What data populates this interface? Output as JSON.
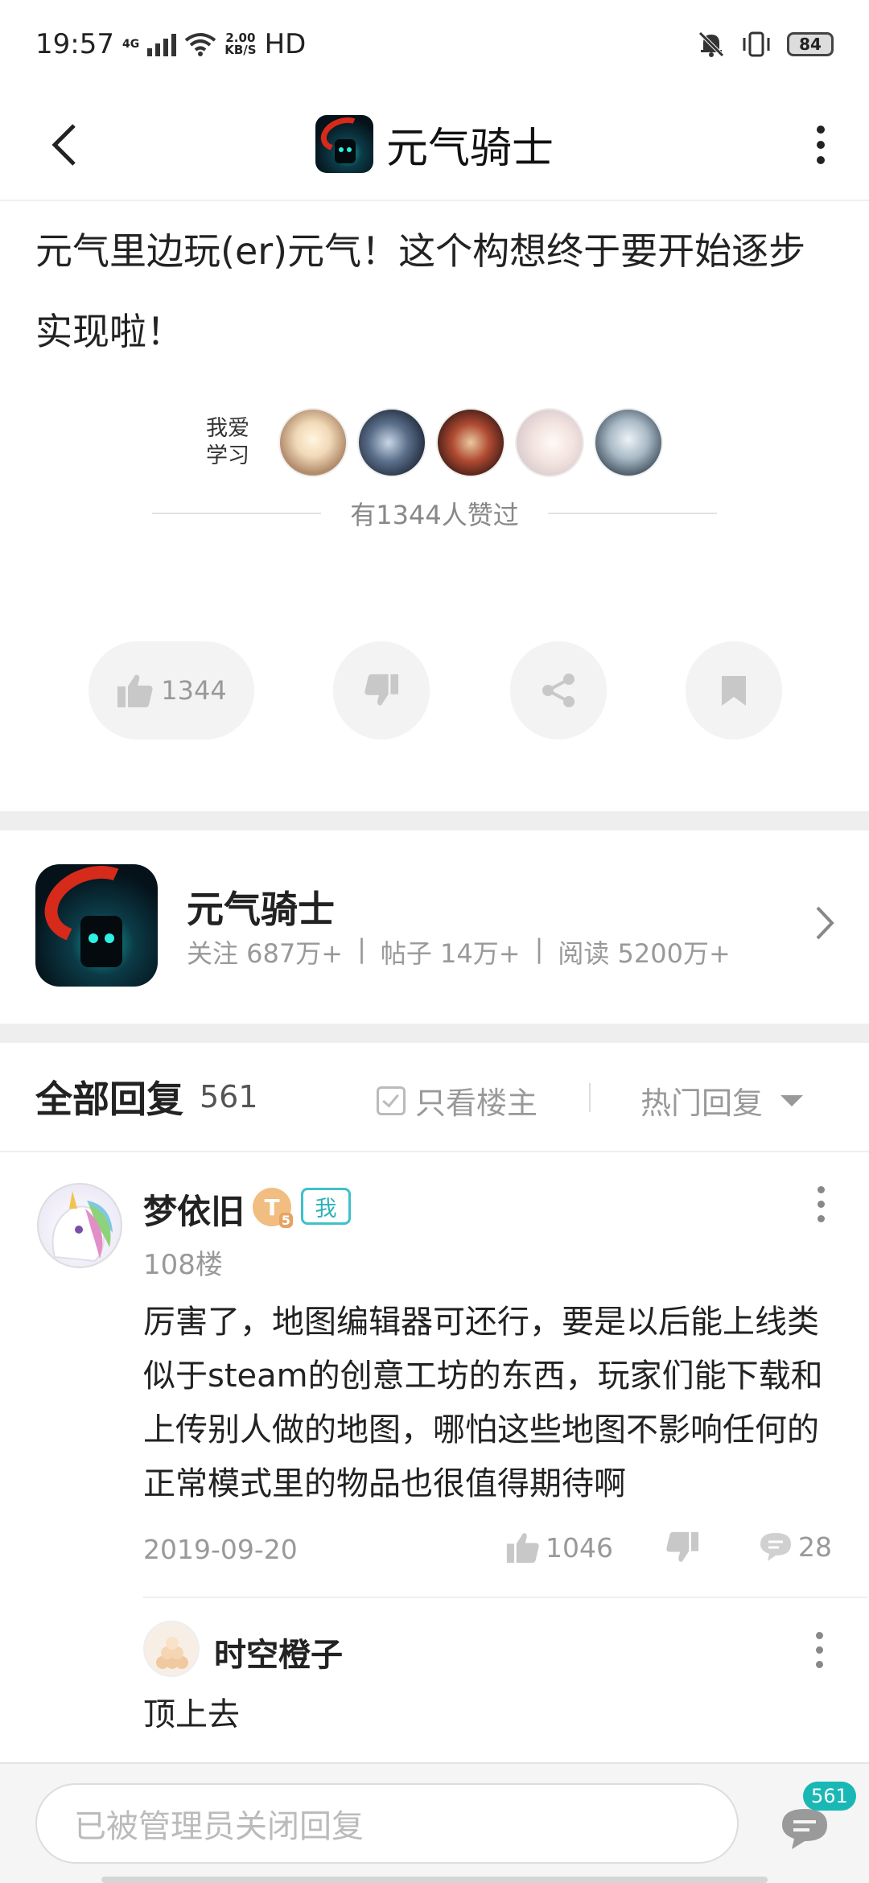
{
  "status_bar": {
    "time": "19:57",
    "network": "4G",
    "speed_value": "2.00",
    "speed_unit": "KB/S",
    "hd": "HD",
    "battery": "84"
  },
  "header": {
    "title": "元气骑士"
  },
  "post": {
    "text": "元气里边玩(er)元气！这个构想终于要开始逐步实现啦！",
    "likers_label": "我爱学习",
    "like_summary": "有1344人赞过",
    "like_count": "1344"
  },
  "game_card": {
    "name": "元气骑士",
    "follow": "关注 687万+",
    "posts": "帖子 14万+",
    "reads": "阅读 5200万+",
    "separator": "|"
  },
  "replies": {
    "title": "全部回复",
    "count": "561",
    "only_op_label": "只看楼主",
    "sort_label": "热门回复"
  },
  "reply_1": {
    "username": "梦依旧",
    "level": "T",
    "level_num": "5",
    "me_badge": "我",
    "floor": "108楼",
    "text": "厉害了，地图编辑器可还行，要是以后能上线类似于steam的创意工坊的东西，玩家们能下载和上传别人做的地图，哪怕这些地图不影响任何的正常模式里的物品也很值得期待啊",
    "date": "2019-09-20",
    "likes": "1046",
    "comments": "28"
  },
  "sub_reply": {
    "username": "时空橙子",
    "text": "顶上去"
  },
  "bottom": {
    "input_placeholder": "已被管理员关闭回复",
    "comment_badge": "561"
  },
  "colors": {
    "accent": "#19b8b5",
    "muted": "#999999",
    "level_badge": "#f1bd81"
  }
}
